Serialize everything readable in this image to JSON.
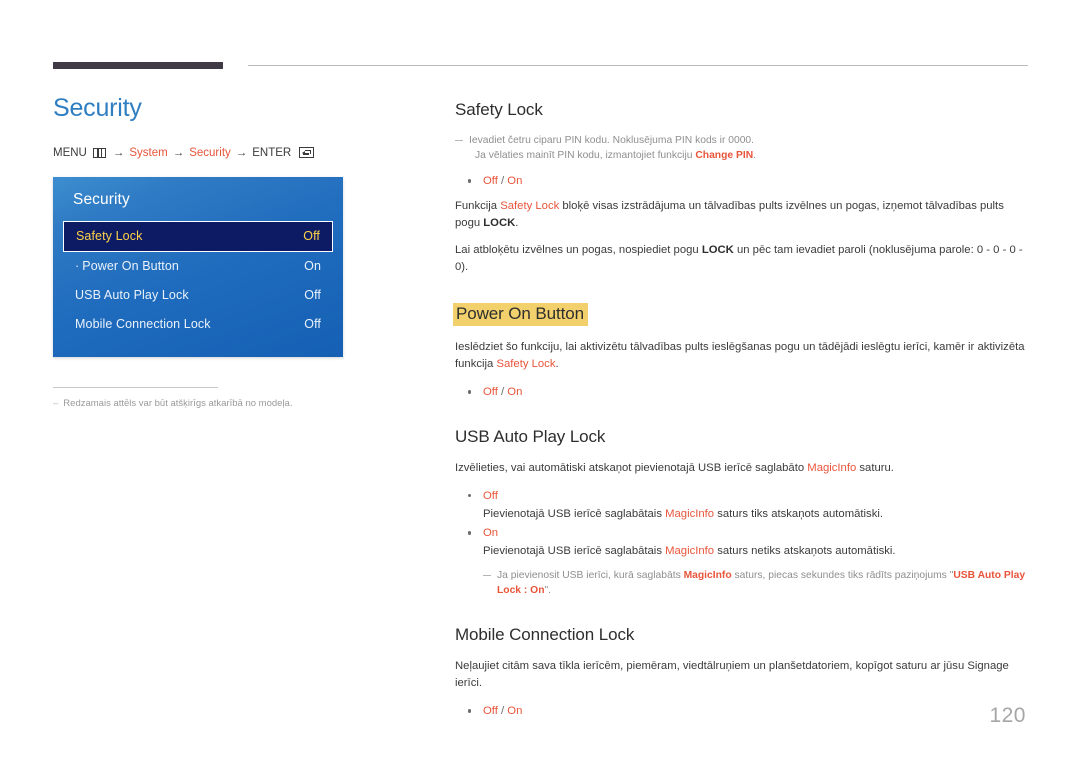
{
  "page": {
    "number": "120"
  },
  "left": {
    "title": "Security",
    "breadcrumb": {
      "menu_label": "MENU",
      "menu_icon": "menu-grid-icon",
      "arrow": "→",
      "item1": "System",
      "item2": "Security",
      "enter_label": "ENTER",
      "enter_icon": "enter-return-icon"
    },
    "osd": {
      "title": "Security",
      "rows": [
        {
          "label": "Safety Lock",
          "value": "Off",
          "selected": true,
          "sub": false
        },
        {
          "label": "Power On Button",
          "value": "On",
          "selected": false,
          "sub": true
        },
        {
          "label": "USB Auto Play Lock",
          "value": "Off",
          "selected": false,
          "sub": false
        },
        {
          "label": "Mobile Connection Lock",
          "value": "Off",
          "selected": false,
          "sub": false
        }
      ]
    },
    "figure_note": {
      "dash": "–",
      "text": "Redzamais attēls var būt atšķirīgs atkarībā no modeļa."
    }
  },
  "sections": {
    "safety_lock": {
      "heading": "Safety Lock",
      "note_line1": "Ievadiet četru ciparu PIN kodu. Noklusējuma PIN kods ir 0000.",
      "note_line2_pre": "Ja vēlaties mainīt PIN kodu, izmantojiet funkciju ",
      "note_line2_accent": "Change PIN",
      "note_line2_post": ".",
      "option_off": "Off",
      "option_slash": " / ",
      "option_on": "On",
      "para1_pre": "Funkcija ",
      "para1_accent": "Safety Lock",
      "para1_mid": " bloķē visas izstrādājuma un tālvadības pults izvēlnes un pogas, izņemot tālvadības pults pogu ",
      "para1_bold": "LOCK",
      "para1_post": ".",
      "para2_pre": "Lai atbloķētu izvēlnes un pogas, nospiediet pogu ",
      "para2_bold": "LOCK",
      "para2_post": " un pēc tam ievadiet paroli (noklusējuma parole: 0 - 0 - 0 - 0)."
    },
    "power_on_button": {
      "heading": "Power On Button",
      "para1_pre": "Ieslēdziet šo funkciju, lai aktivizētu tālvadības pults ieslēgšanas pogu un tādējādi ieslēgtu ierīci, kamēr ir aktivizēta funkcija ",
      "para1_accent": "Safety Lock",
      "para1_post": ".",
      "option_off": "Off",
      "option_slash": " / ",
      "option_on": "On"
    },
    "usb_auto_play_lock": {
      "heading": "USB Auto Play Lock",
      "para1_pre": "Izvēlieties, vai automātiski atskaņot pievienotajā USB ierīcē saglabāto ",
      "para1_accent": "MagicInfo",
      "para1_post": " saturu.",
      "bullet_off_label": "Off",
      "bullet_off_desc_pre": "Pievienotajā USB ierīcē saglabātais ",
      "bullet_off_desc_accent": "MagicInfo",
      "bullet_off_desc_post": " saturs tiks atskaņots automātiski.",
      "bullet_on_label": "On",
      "bullet_on_desc_pre": "Pievienotajā USB ierīcē saglabātais ",
      "bullet_on_desc_accent": "MagicInfo",
      "bullet_on_desc_post": " saturs netiks atskaņots automātiski.",
      "note_pre": "Ja pievienosit USB ierīci, kurā saglabāts ",
      "note_accent1": "MagicInfo",
      "note_mid": " saturs, piecas sekundes tiks rādīts paziņojums \"",
      "note_accent2": "USB Auto Play Lock : On",
      "note_post": "\"."
    },
    "mobile_connection_lock": {
      "heading": "Mobile Connection Lock",
      "para1": "Neļaujiet citām sava tīkla ierīcēm, piemēram, viedtālruņiem un planšetdatoriem, kopīgot saturu ar jūsu Signage ierīci.",
      "option_off": "Off",
      "option_slash": " / ",
      "option_on": "On"
    }
  },
  "colors": {
    "accent": "#e8553a",
    "title_blue": "#2f7ec1",
    "osd_blue": "#1f6bbd",
    "osd_selected_bg": "#0c1b63",
    "osd_selected_text": "#ffd24a",
    "highlight_yellow": "#f2d06b",
    "header_bar": "#403a47"
  }
}
